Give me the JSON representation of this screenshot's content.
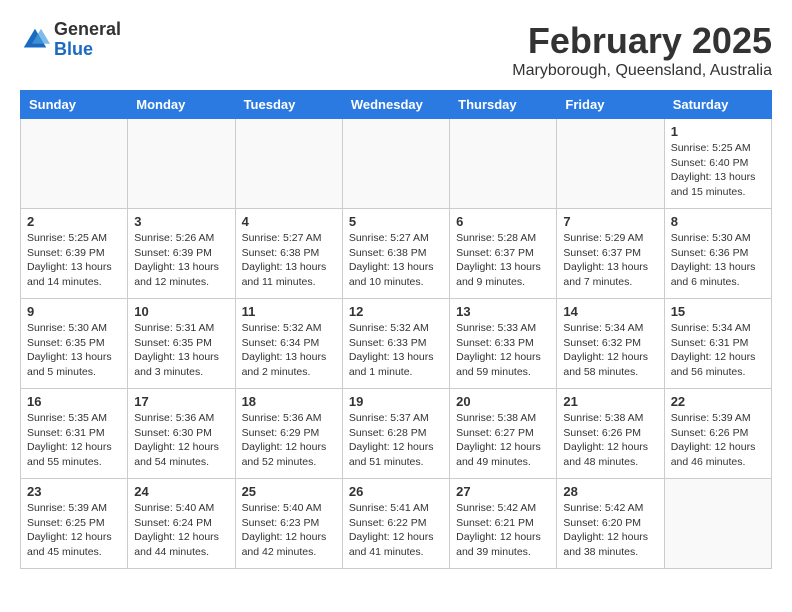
{
  "header": {
    "logo_general": "General",
    "logo_blue": "Blue",
    "month_title": "February 2025",
    "location": "Maryborough, Queensland, Australia"
  },
  "weekdays": [
    "Sunday",
    "Monday",
    "Tuesday",
    "Wednesday",
    "Thursday",
    "Friday",
    "Saturday"
  ],
  "weeks": [
    [
      {
        "day": "",
        "info": ""
      },
      {
        "day": "",
        "info": ""
      },
      {
        "day": "",
        "info": ""
      },
      {
        "day": "",
        "info": ""
      },
      {
        "day": "",
        "info": ""
      },
      {
        "day": "",
        "info": ""
      },
      {
        "day": "1",
        "info": "Sunrise: 5:25 AM\nSunset: 6:40 PM\nDaylight: 13 hours\nand 15 minutes."
      }
    ],
    [
      {
        "day": "2",
        "info": "Sunrise: 5:25 AM\nSunset: 6:39 PM\nDaylight: 13 hours\nand 14 minutes."
      },
      {
        "day": "3",
        "info": "Sunrise: 5:26 AM\nSunset: 6:39 PM\nDaylight: 13 hours\nand 12 minutes."
      },
      {
        "day": "4",
        "info": "Sunrise: 5:27 AM\nSunset: 6:38 PM\nDaylight: 13 hours\nand 11 minutes."
      },
      {
        "day": "5",
        "info": "Sunrise: 5:27 AM\nSunset: 6:38 PM\nDaylight: 13 hours\nand 10 minutes."
      },
      {
        "day": "6",
        "info": "Sunrise: 5:28 AM\nSunset: 6:37 PM\nDaylight: 13 hours\nand 9 minutes."
      },
      {
        "day": "7",
        "info": "Sunrise: 5:29 AM\nSunset: 6:37 PM\nDaylight: 13 hours\nand 7 minutes."
      },
      {
        "day": "8",
        "info": "Sunrise: 5:30 AM\nSunset: 6:36 PM\nDaylight: 13 hours\nand 6 minutes."
      }
    ],
    [
      {
        "day": "9",
        "info": "Sunrise: 5:30 AM\nSunset: 6:35 PM\nDaylight: 13 hours\nand 5 minutes."
      },
      {
        "day": "10",
        "info": "Sunrise: 5:31 AM\nSunset: 6:35 PM\nDaylight: 13 hours\nand 3 minutes."
      },
      {
        "day": "11",
        "info": "Sunrise: 5:32 AM\nSunset: 6:34 PM\nDaylight: 13 hours\nand 2 minutes."
      },
      {
        "day": "12",
        "info": "Sunrise: 5:32 AM\nSunset: 6:33 PM\nDaylight: 13 hours\nand 1 minute."
      },
      {
        "day": "13",
        "info": "Sunrise: 5:33 AM\nSunset: 6:33 PM\nDaylight: 12 hours\nand 59 minutes."
      },
      {
        "day": "14",
        "info": "Sunrise: 5:34 AM\nSunset: 6:32 PM\nDaylight: 12 hours\nand 58 minutes."
      },
      {
        "day": "15",
        "info": "Sunrise: 5:34 AM\nSunset: 6:31 PM\nDaylight: 12 hours\nand 56 minutes."
      }
    ],
    [
      {
        "day": "16",
        "info": "Sunrise: 5:35 AM\nSunset: 6:31 PM\nDaylight: 12 hours\nand 55 minutes."
      },
      {
        "day": "17",
        "info": "Sunrise: 5:36 AM\nSunset: 6:30 PM\nDaylight: 12 hours\nand 54 minutes."
      },
      {
        "day": "18",
        "info": "Sunrise: 5:36 AM\nSunset: 6:29 PM\nDaylight: 12 hours\nand 52 minutes."
      },
      {
        "day": "19",
        "info": "Sunrise: 5:37 AM\nSunset: 6:28 PM\nDaylight: 12 hours\nand 51 minutes."
      },
      {
        "day": "20",
        "info": "Sunrise: 5:38 AM\nSunset: 6:27 PM\nDaylight: 12 hours\nand 49 minutes."
      },
      {
        "day": "21",
        "info": "Sunrise: 5:38 AM\nSunset: 6:26 PM\nDaylight: 12 hours\nand 48 minutes."
      },
      {
        "day": "22",
        "info": "Sunrise: 5:39 AM\nSunset: 6:26 PM\nDaylight: 12 hours\nand 46 minutes."
      }
    ],
    [
      {
        "day": "23",
        "info": "Sunrise: 5:39 AM\nSunset: 6:25 PM\nDaylight: 12 hours\nand 45 minutes."
      },
      {
        "day": "24",
        "info": "Sunrise: 5:40 AM\nSunset: 6:24 PM\nDaylight: 12 hours\nand 44 minutes."
      },
      {
        "day": "25",
        "info": "Sunrise: 5:40 AM\nSunset: 6:23 PM\nDaylight: 12 hours\nand 42 minutes."
      },
      {
        "day": "26",
        "info": "Sunrise: 5:41 AM\nSunset: 6:22 PM\nDaylight: 12 hours\nand 41 minutes."
      },
      {
        "day": "27",
        "info": "Sunrise: 5:42 AM\nSunset: 6:21 PM\nDaylight: 12 hours\nand 39 minutes."
      },
      {
        "day": "28",
        "info": "Sunrise: 5:42 AM\nSunset: 6:20 PM\nDaylight: 12 hours\nand 38 minutes."
      },
      {
        "day": "",
        "info": ""
      }
    ]
  ]
}
